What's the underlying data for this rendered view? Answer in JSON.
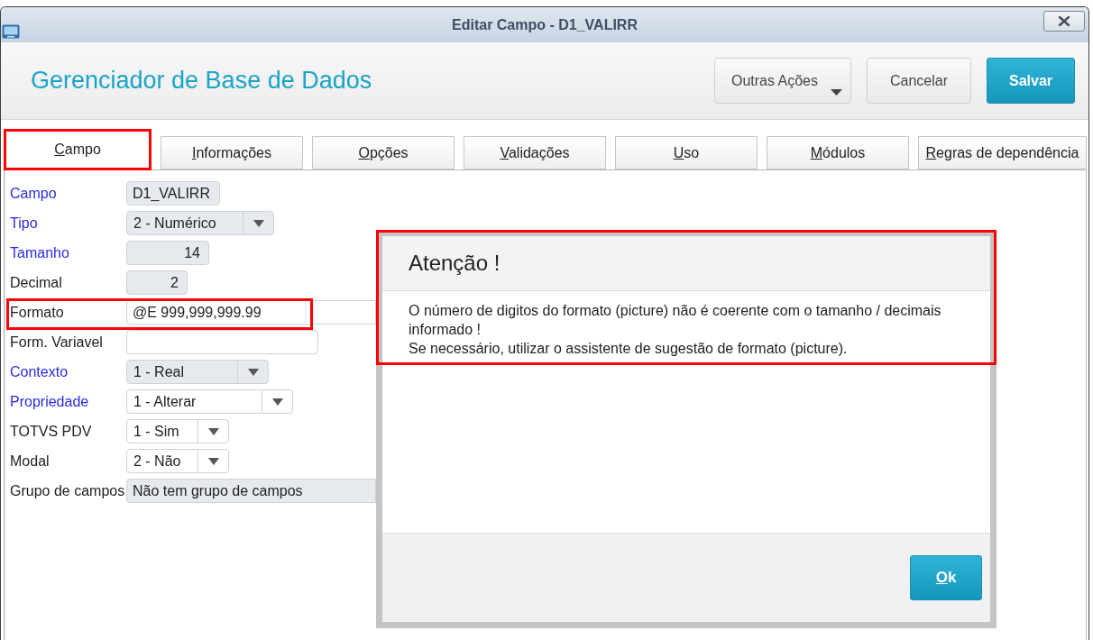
{
  "window": {
    "title": "Editar Campo - D1_VALIRR"
  },
  "header": {
    "title": "Gerenciador de Base de Dados",
    "buttons": [
      {
        "label": "Outras Ações",
        "kind": "menu"
      },
      {
        "label": "Cancelar",
        "kind": "default"
      },
      {
        "label": "Salvar",
        "kind": "primary"
      }
    ]
  },
  "tabs": [
    {
      "label": "Campo",
      "selected": true,
      "highlighted": true
    },
    {
      "label": "Informações",
      "selected": false,
      "highlighted": false
    },
    {
      "label": "Opções",
      "selected": false,
      "highlighted": false
    },
    {
      "label": "Validações",
      "selected": false,
      "highlighted": false
    },
    {
      "label": "Uso",
      "selected": false,
      "highlighted": false
    },
    {
      "label": "Módulos",
      "selected": false,
      "highlighted": false
    },
    {
      "label": "Regras de dependência",
      "selected": false,
      "highlighted": false
    }
  ],
  "fields": [
    {
      "label": "Campo",
      "mandatory": true,
      "kind": "text",
      "disabled": true,
      "value": "D1_VALIRR",
      "highlighted": false
    },
    {
      "label": "Tipo",
      "mandatory": true,
      "kind": "select",
      "disabled": true,
      "value": "2 - Numérico",
      "highlighted": false
    },
    {
      "label": "Tamanho",
      "mandatory": true,
      "kind": "number",
      "disabled": true,
      "value": "14",
      "highlighted": false
    },
    {
      "label": "Decimal",
      "mandatory": false,
      "kind": "number",
      "disabled": true,
      "value": "2",
      "highlighted": false
    },
    {
      "label": "Formato",
      "mandatory": false,
      "kind": "text",
      "disabled": false,
      "value": "@E 999,999,999.99",
      "highlighted": true
    },
    {
      "label": "Form. Variavel",
      "mandatory": false,
      "kind": "text",
      "disabled": false,
      "highlighted": false
    },
    {
      "label": "Contexto",
      "mandatory": true,
      "kind": "select",
      "disabled": true,
      "value": "1 - Real",
      "highlighted": false
    },
    {
      "label": "Propriedade",
      "mandatory": true,
      "kind": "select",
      "disabled": false,
      "value": "1 - Alterar",
      "highlighted": false
    },
    {
      "label": "TOTVS PDV",
      "mandatory": false,
      "kind": "select",
      "disabled": false,
      "value": "1 - Sim",
      "highlighted": false
    },
    {
      "label": "Modal",
      "mandatory": false,
      "kind": "select",
      "disabled": false,
      "value": "2 - Não",
      "highlighted": false
    },
    {
      "label": "Grupo de campos",
      "mandatory": false,
      "kind": "text",
      "disabled": true,
      "value": "Não tem grupo de campos",
      "highlighted": false
    }
  ],
  "dialog": {
    "title": "Atenção !",
    "message": [
      "O número de digitos do formato (picture) não é coerente com o tamanho / decimais informado !",
      "Se necessário, utilizar o assistente de sugestão de formato (picture)."
    ],
    "highlighted": true,
    "button": "Ok"
  }
}
